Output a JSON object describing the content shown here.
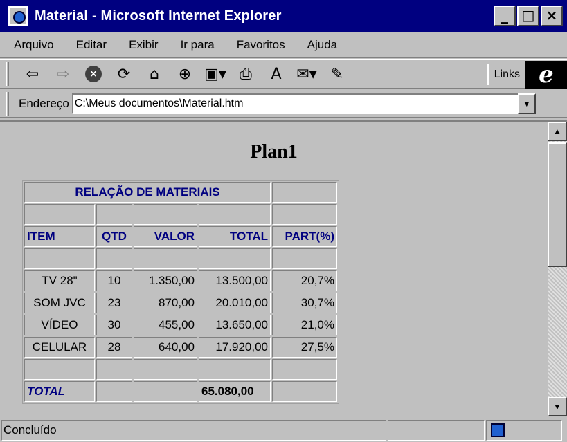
{
  "window": {
    "title": "Material - Microsoft Internet Explorer",
    "minimize": "_",
    "maximize": "□",
    "close": "×"
  },
  "menu": [
    "Arquivo",
    "Editar",
    "Exibir",
    "Ir para",
    "Favoritos",
    "Ajuda"
  ],
  "toolbar": {
    "links_label": "Links",
    "ie_logo": "e",
    "icons": [
      "back-icon",
      "forward-icon",
      "stop-icon",
      "refresh-icon",
      "home-icon",
      "search-icon",
      "favorites-icon",
      "print-icon",
      "font-icon",
      "mail-icon",
      "edit-icon"
    ]
  },
  "address": {
    "label": "Endereço",
    "value": "C:\\Meus documentos\\Material.htm"
  },
  "page": {
    "title": "Plan1",
    "table": {
      "caption": "RELAÇÃO DE MATERIAIS",
      "headers": [
        "ITEM",
        "QTD",
        "VALOR",
        "TOTAL",
        "PART(%)"
      ],
      "rows": [
        [
          "TV 28\"",
          "10",
          "1.350,00",
          "13.500,00",
          "20,7%"
        ],
        [
          "SOM JVC",
          "23",
          "870,00",
          "20.010,00",
          "30,7%"
        ],
        [
          "VÍDEO",
          "30",
          "455,00",
          "13.650,00",
          "21,0%"
        ],
        [
          "CELULAR",
          "28",
          "640,00",
          "17.920,00",
          "27,5%"
        ]
      ],
      "total_label": "TOTAL",
      "total_value": "65.080,00"
    }
  },
  "status": {
    "text": "Concluído"
  }
}
